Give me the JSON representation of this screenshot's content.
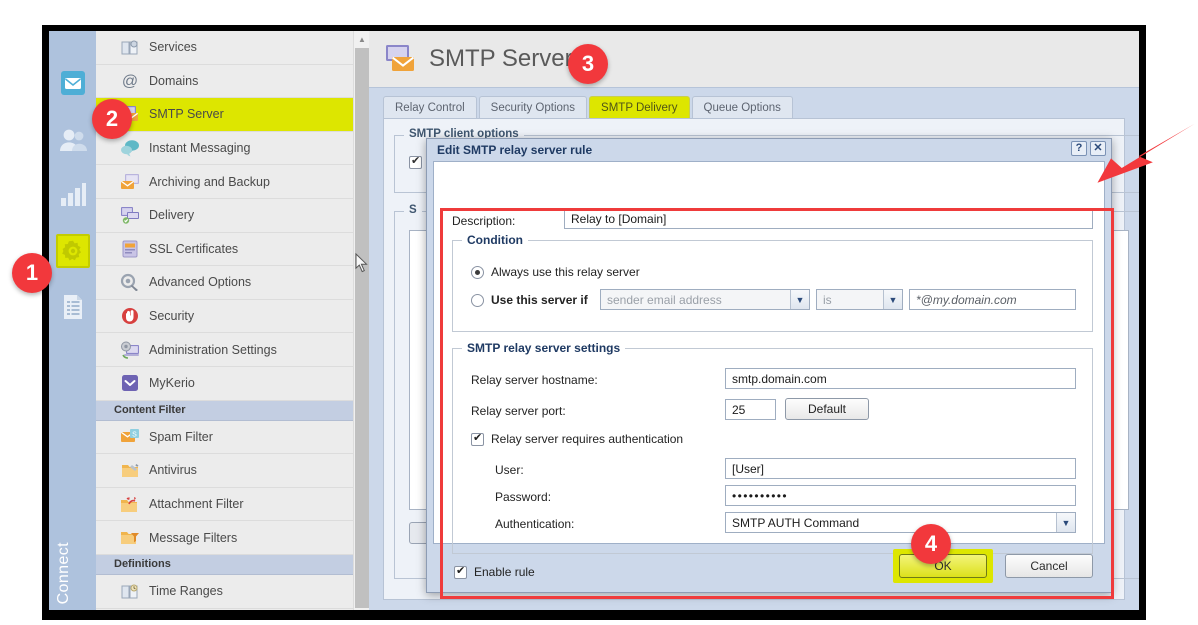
{
  "window": {
    "page_title": "SMTP Server",
    "page_icon": "smtp-server-icon"
  },
  "rail": {
    "word": "Connect",
    "icons": [
      {
        "name": "mail-icon",
        "active": false
      },
      {
        "name": "users-icon",
        "active": false
      },
      {
        "name": "statistics-icon",
        "active": false
      },
      {
        "name": "configuration-gear-icon",
        "active": true
      },
      {
        "name": "logs-icon",
        "active": false
      }
    ]
  },
  "sidebar": {
    "items": [
      {
        "label": "Services",
        "icon": "services-icon",
        "selected": false
      },
      {
        "label": "Domains",
        "icon": "at-icon",
        "selected": false
      },
      {
        "label": "SMTP Server",
        "icon": "smtp-server-icon",
        "selected": true
      },
      {
        "label": "Instant Messaging",
        "icon": "chat-icon",
        "selected": false
      },
      {
        "label": "Archiving and Backup",
        "icon": "archive-icon",
        "selected": false
      },
      {
        "label": "Delivery",
        "icon": "delivery-icon",
        "selected": false
      },
      {
        "label": "SSL Certificates",
        "icon": "certificate-icon",
        "selected": false
      },
      {
        "label": "Advanced Options",
        "icon": "advanced-gear-icon",
        "selected": false
      },
      {
        "label": "Security",
        "icon": "security-shield-icon",
        "selected": false
      },
      {
        "label": "Administration Settings",
        "icon": "admin-settings-icon",
        "selected": false
      },
      {
        "label": "MyKerio",
        "icon": "mykerio-icon",
        "selected": false
      }
    ],
    "group_content_filter": "Content Filter",
    "content_filter_items": [
      {
        "label": "Spam Filter",
        "icon": "spam-filter-icon"
      },
      {
        "label": "Antivirus",
        "icon": "antivirus-icon"
      },
      {
        "label": "Attachment Filter",
        "icon": "attachment-filter-icon"
      },
      {
        "label": "Message Filters",
        "icon": "message-filters-icon"
      }
    ],
    "group_definitions": "Definitions",
    "definitions_items": [
      {
        "label": "Time Ranges",
        "icon": "time-ranges-icon"
      }
    ]
  },
  "tabs": [
    {
      "label": "Relay Control",
      "active": false
    },
    {
      "label": "Security Options",
      "active": false
    },
    {
      "label": "SMTP Delivery",
      "active": true
    },
    {
      "label": "Queue Options",
      "active": false
    }
  ],
  "background_panel": {
    "client_options_legend": "SMTP client options",
    "second_legend": "S"
  },
  "dialog": {
    "title": "Edit SMTP relay server rule",
    "help_button": "?",
    "close_button": "✕",
    "description_label": "Description:",
    "description_value": "Relay to [Domain]",
    "condition": {
      "legend": "Condition",
      "always_label": "Always use this relay server",
      "always_selected": true,
      "conditional_label": "Use this server if",
      "conditional_selected": false,
      "field_placeholder": "sender email address",
      "operator_value": "is",
      "pattern_value": "*@my.domain.com"
    },
    "relay_settings": {
      "legend": "SMTP relay server settings",
      "hostname_label": "Relay server hostname:",
      "hostname_value": "smtp.domain.com",
      "port_label": "Relay server port:",
      "port_value": "25",
      "default_button": "Default",
      "auth_checkbox_label": "Relay server requires authentication",
      "auth_checkbox_checked": true,
      "user_label": "User:",
      "user_value": "[User]",
      "password_label": "Password:",
      "password_value": "••••••••••",
      "authentication_label": "Authentication:",
      "authentication_value": "SMTP AUTH Command"
    },
    "enable_rule_label": "Enable rule",
    "enable_rule_checked": true,
    "ok_button": "OK",
    "cancel_button": "Cancel"
  },
  "annotations": {
    "badges": [
      {
        "number": "1",
        "target": "configuration-gear-rail-icon"
      },
      {
        "number": "2",
        "target": "sidebar-item-smtp-server"
      },
      {
        "number": "3",
        "target": "tab-smtp-delivery"
      },
      {
        "number": "4",
        "target": "ok-button"
      }
    ],
    "arrow": {
      "name": "red-arrow",
      "points_to": "dialog-close-area"
    },
    "highlight_color": "#dde600",
    "badge_color": "#f2383c",
    "callout_rect_color": "#ef3b3b"
  }
}
